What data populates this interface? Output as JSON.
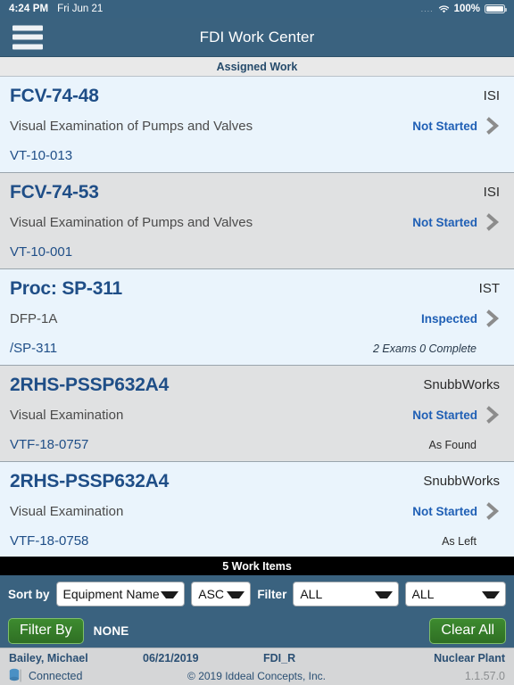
{
  "statusbar": {
    "time": "4:24 PM",
    "date": "Fri Jun 21",
    "dots": "....",
    "wifi_icon": "wifi-icon",
    "battery_pct": "100%",
    "battery_icon": "battery-full-icon"
  },
  "navbar": {
    "menu_icon": "hamburger-menu-icon",
    "title": "FDI Work Center"
  },
  "section": {
    "header": "Assigned Work"
  },
  "work_items": [
    {
      "name": "FCV-74-48",
      "type": "ISI",
      "description": "Visual Examination of Pumps and Valves",
      "reference": "VT-10-013",
      "status": "Not Started",
      "sub": "",
      "chevron_icon": "chevron-right-icon"
    },
    {
      "name": "FCV-74-53",
      "type": "ISI",
      "description": "Visual Examination of Pumps and Valves",
      "reference": "VT-10-001",
      "status": "Not Started",
      "sub": "",
      "chevron_icon": "chevron-right-icon"
    },
    {
      "name": "Proc: SP-311",
      "type": "IST",
      "description": "DFP-1A",
      "reference": "/SP-311",
      "status": "Inspected",
      "sub": "2 Exams  0 Complete",
      "sub_italic": true,
      "chevron_icon": "chevron-right-icon"
    },
    {
      "name": "2RHS-PSSP632A4",
      "type": "SnubbWorks",
      "description": "Visual Examination",
      "reference": "VTF-18-0757",
      "status": "Not Started",
      "sub": "As Found",
      "chevron_icon": "chevron-right-icon"
    },
    {
      "name": "2RHS-PSSP632A4",
      "type": "SnubbWorks",
      "description": "Visual Examination",
      "reference": "VTF-18-0758",
      "status": "Not Started",
      "sub": "As Left",
      "chevron_icon": "chevron-right-icon"
    }
  ],
  "count_bar": {
    "text": "5 Work Items"
  },
  "sortbar": {
    "sort_label": "Sort by",
    "sort_field": "Equipment Name",
    "sort_direction": "ASC",
    "filter_label": "Filter",
    "filter_one": "ALL",
    "filter_two": "ALL",
    "caret_icon": "chevron-down-icon"
  },
  "filterbar": {
    "filter_by_label": "Filter By",
    "filter_value": "NONE",
    "clear_all_label": "Clear All"
  },
  "footer": {
    "user": "Bailey, Michael",
    "date": "06/21/2019",
    "app": "FDI_R",
    "plant": "Nuclear Plant",
    "db_icon": "database-icon",
    "connection": "Connected",
    "copyright": "© 2019 Iddeal Concepts, Inc.",
    "version": "1.1.57.0"
  },
  "colors": {
    "nav_blue": "#3a627f",
    "row_blue": "#eaf4fc",
    "row_gray": "#e0e1e2",
    "name_blue": "#1f4e87",
    "status_blue": "#1f5fb5",
    "green_button": "#3d8b2f",
    "count_bar_black": "#000000"
  }
}
